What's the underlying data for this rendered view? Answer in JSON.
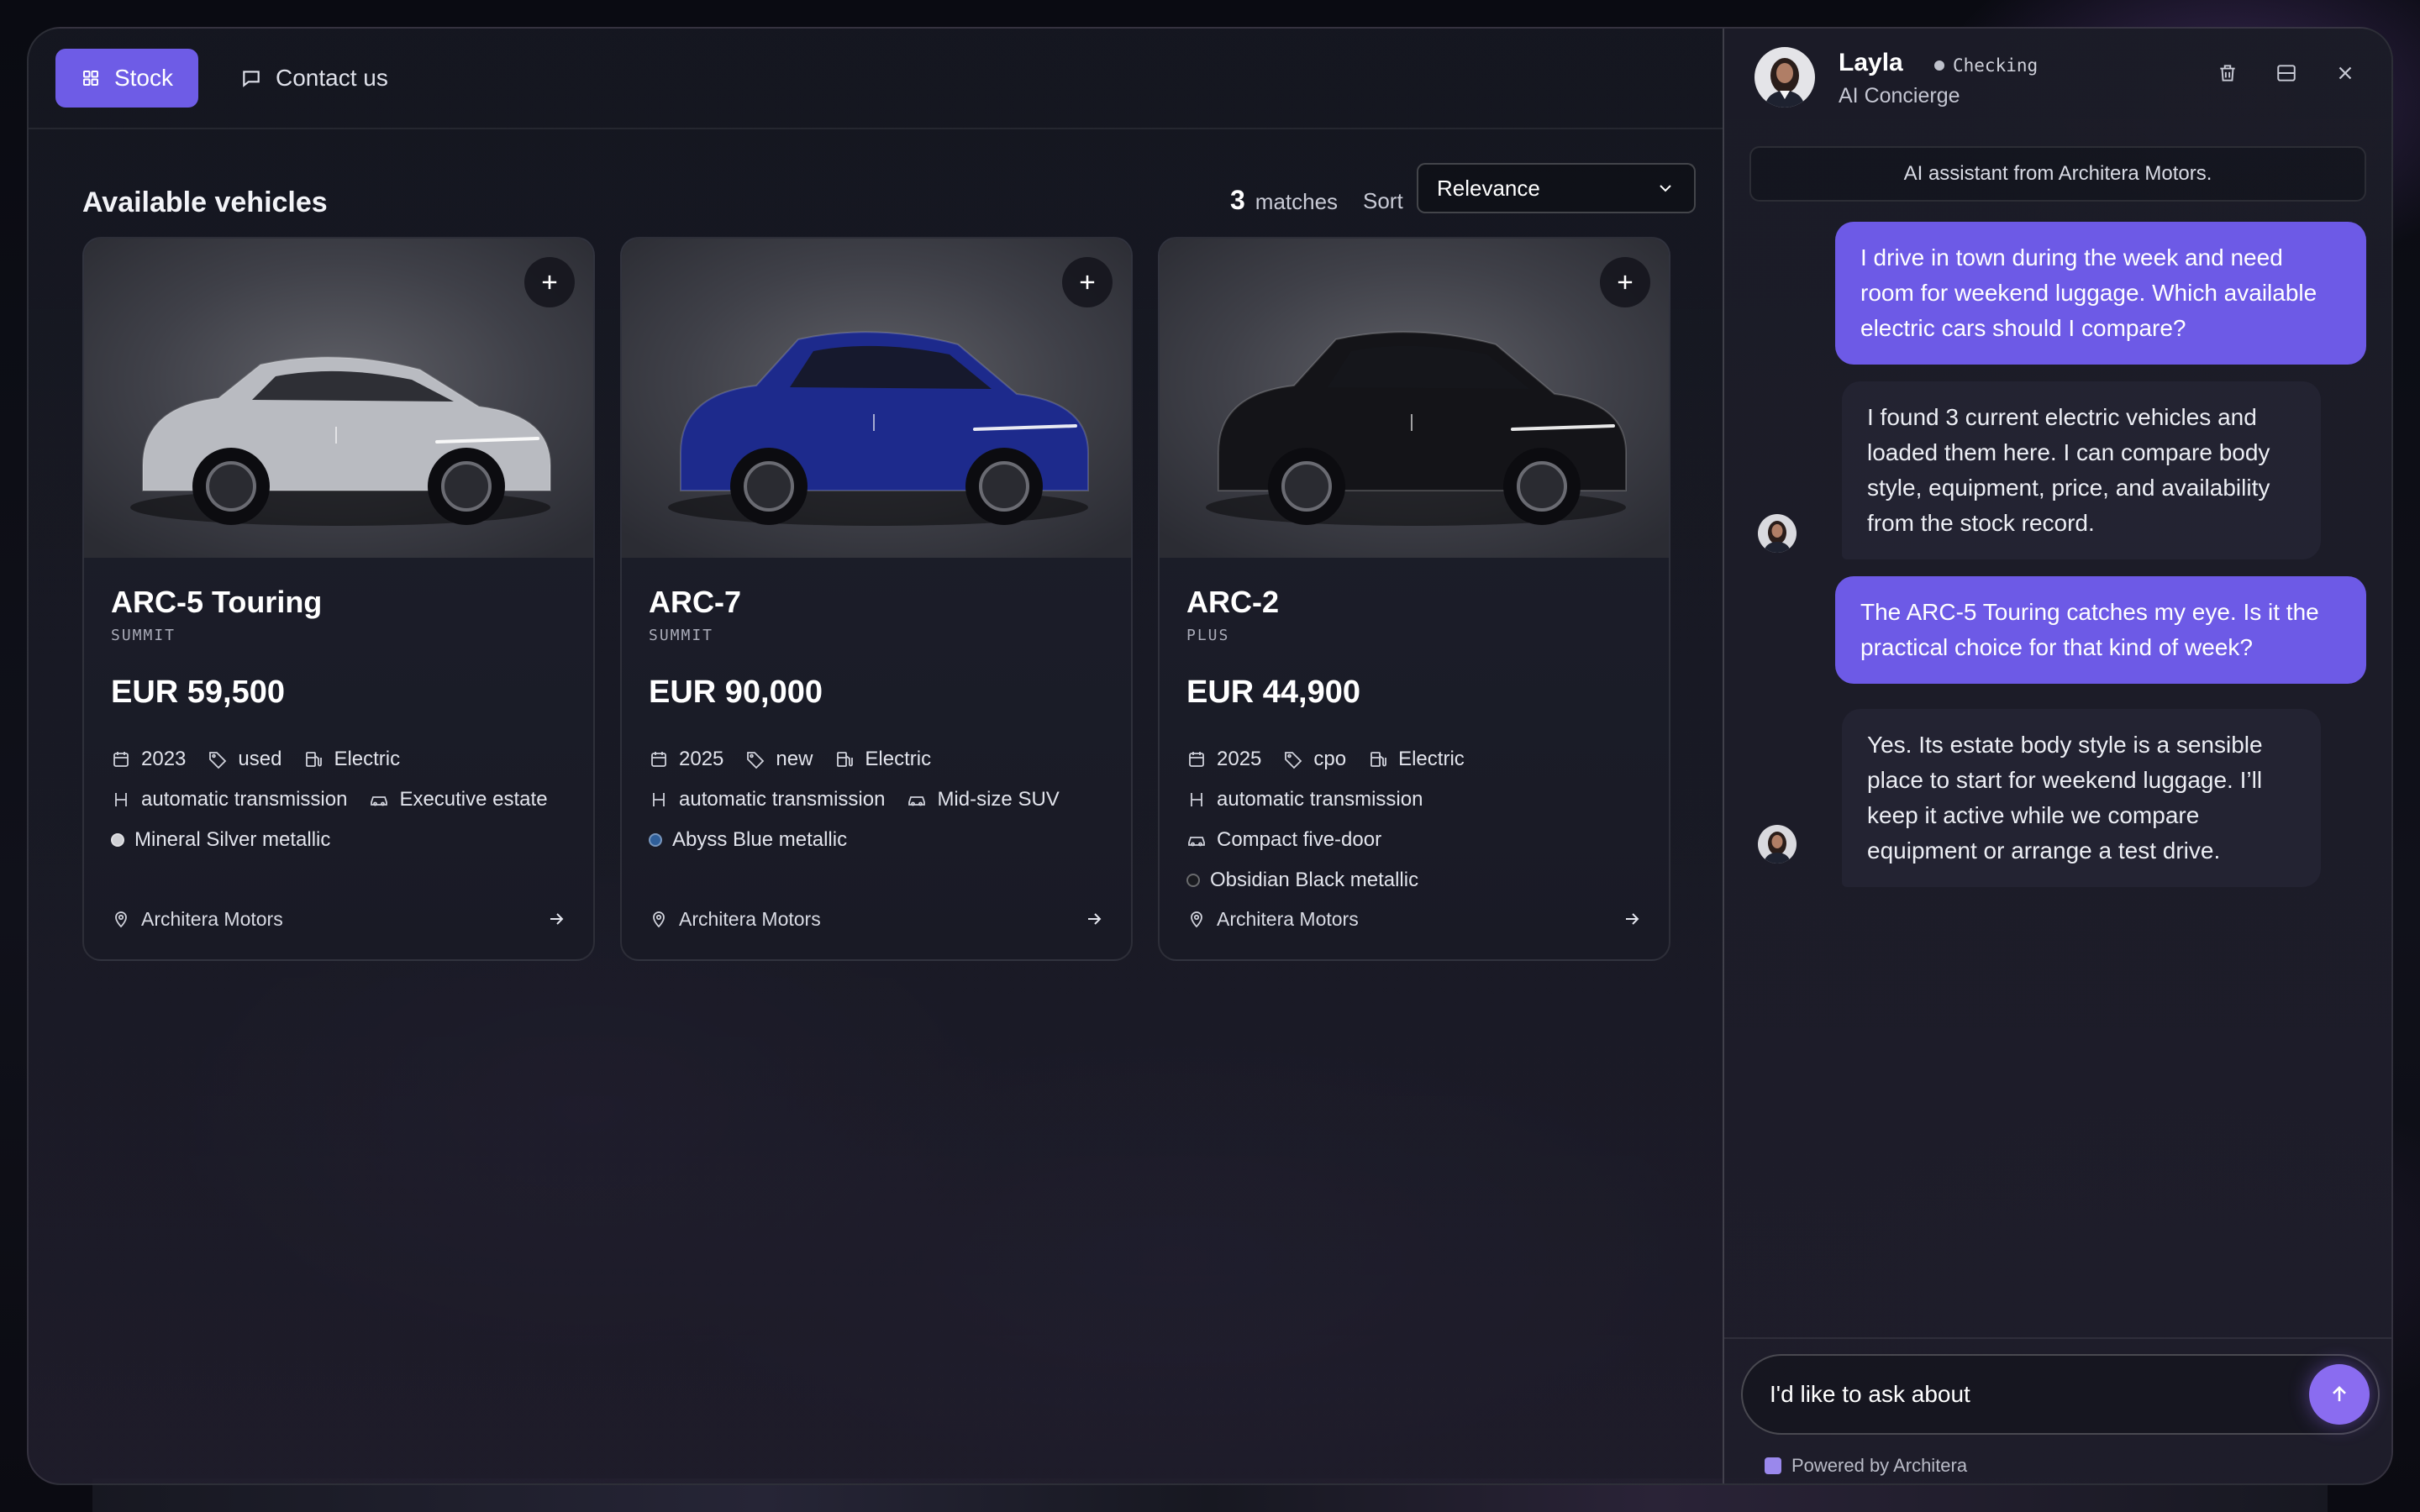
{
  "colors": {
    "accent": "#6e5ce6",
    "user_bubble": "#6d5ae6",
    "send_button": "#8a6cf0"
  },
  "nav": {
    "stock_label": "Stock",
    "contact_label": "Contact us"
  },
  "listing": {
    "title": "Available vehicles",
    "match_count": "3",
    "match_label": "matches",
    "sort_label": "Sort",
    "sort_value": "Relevance"
  },
  "cards": [
    {
      "name": "ARC-5 Touring",
      "trim": "SUMMIT",
      "price": "EUR 59,500",
      "year": "2023",
      "condition": "used",
      "fuel": "Electric",
      "transmission": "automatic transmission",
      "body": "Executive estate",
      "color_name": "Mineral Silver metallic",
      "color_swatch": "#cfd0d4",
      "dealer": "Architera Motors",
      "paint": "#b9bbc1"
    },
    {
      "name": "ARC-7",
      "trim": "SUMMIT",
      "price": "EUR 90,000",
      "year": "2025",
      "condition": "new",
      "fuel": "Electric",
      "transmission": "automatic transmission",
      "body": "Mid-size SUV",
      "color_name": "Abyss Blue metallic",
      "color_swatch": "#2f5f9a",
      "dealer": "Architera Motors",
      "paint": "#1d2a8c"
    },
    {
      "name": "ARC-2",
      "trim": "PLUS",
      "price": "EUR 44,900",
      "year": "2025",
      "condition": "cpo",
      "fuel": "Electric",
      "transmission": "automatic transmission",
      "body": "Compact five-door",
      "color_name": "Obsidian Black metallic",
      "color_swatch": "#1a1b20",
      "dealer": "Architera Motors",
      "paint": "#141418"
    }
  ],
  "chat": {
    "agent_name": "Layla",
    "status": "Checking",
    "role": "AI Concierge",
    "disclaimer": "AI assistant from Architera Motors.",
    "messages": [
      {
        "from": "user",
        "text": "I drive in town during the week and need room for weekend luggage. Which available electric cars should I compare?"
      },
      {
        "from": "bot",
        "text": "I found 3 current electric vehicles and loaded them here. I can compare body style, equipment, price, and availability from the stock record."
      },
      {
        "from": "user",
        "text": "The ARC-5 Touring catches my eye. Is it the practical choice for that kind of week?"
      },
      {
        "from": "bot",
        "text": "Yes. Its estate body style is a sensible place to start for weekend luggage. I’ll keep it active while we compare equipment or arrange a test drive."
      }
    ],
    "input_value": "I'd like to ask about",
    "powered_by": "Powered by Architera"
  }
}
